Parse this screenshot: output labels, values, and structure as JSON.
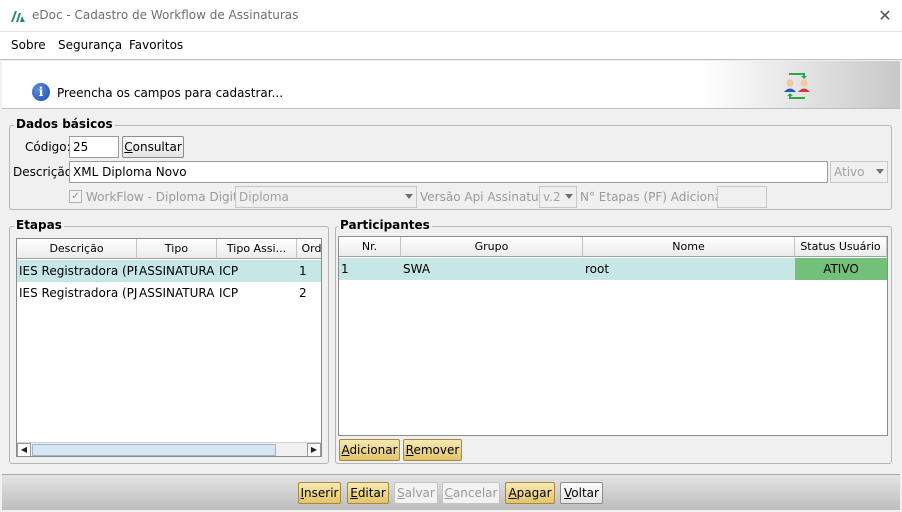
{
  "window": {
    "title": "eDoc - Cadastro de Workflow de Assinaturas"
  },
  "menu": {
    "items": [
      "Sobre",
      "Segurança",
      "Favoritos"
    ]
  },
  "banner": {
    "text": "Preencha os campos para cadastrar..."
  },
  "dados_basicos": {
    "title": "Dados básicos",
    "codigo_label": "Código:",
    "codigo_value": "25",
    "consultar_label": "Consultar",
    "descricao_label": "Descrição:",
    "descricao_value": "XML Diploma Novo",
    "status_value": "Ativo",
    "workflow_checkbox_label": "WorkFlow - Diploma Digital",
    "workflow_value": "Diploma",
    "versao_label": "Versão Api Assinatura:",
    "versao_value": "v.2",
    "etapas_label": "N° Etapas (PF) Adicionais:",
    "etapas_value": ""
  },
  "etapas": {
    "title": "Etapas",
    "columns": [
      "Descrição",
      "Tipo",
      "Tipo Assi...",
      "Ord"
    ],
    "rows": [
      [
        "IES Registradora (PF)",
        "ASSINATURA",
        "ICP",
        "1"
      ],
      [
        "IES Registradora (PJ)",
        "ASSINATURA",
        "ICP",
        "2"
      ]
    ]
  },
  "participantes": {
    "title": "Participantes",
    "columns": [
      "Nr.",
      "Grupo",
      "Nome",
      "Status Usuário"
    ],
    "rows": [
      [
        "1",
        "SWA",
        "root",
        "ATIVO"
      ]
    ],
    "adicionar_label": "Adicionar",
    "remover_label": "Remover"
  },
  "actions": {
    "inserir": "Inserir",
    "editar": "Editar",
    "salvar": "Salvar",
    "cancelar": "Cancelar",
    "apagar": "Apagar",
    "voltar": "Voltar"
  },
  "colors": {
    "selected_row": "#c7e6e6",
    "status_active": "#73c07a",
    "gold_button": "#e3c56a"
  }
}
